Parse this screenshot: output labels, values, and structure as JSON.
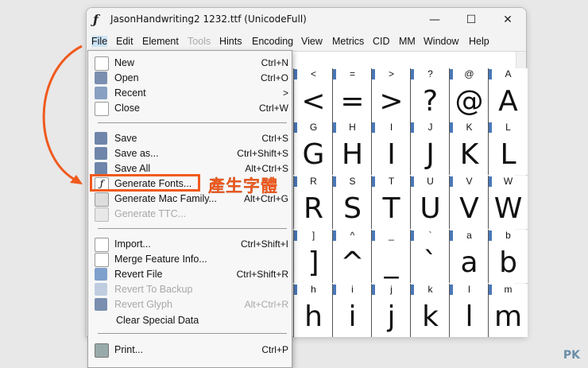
{
  "window": {
    "title": "JasonHandwriting2  1232.ttf (UnicodeFull)",
    "app_icon": "ƒ",
    "minimize_glyph": "—",
    "maximize_glyph": "☐",
    "close_glyph": "✕"
  },
  "menubar": [
    "File",
    "Edit",
    "Element",
    "Tools",
    "Hints",
    "Encoding",
    "View",
    "Metrics",
    "CID",
    "MM",
    "Window",
    "Help"
  ],
  "file_menu": {
    "items": [
      {
        "label": "New",
        "shortcut": "Ctrl+N",
        "icon": "new-file-icon",
        "enabled": true
      },
      {
        "label": "Open",
        "shortcut": "Ctrl+O",
        "icon": "open-icon",
        "enabled": true
      },
      {
        "label": "Recent",
        "shortcut": ">",
        "icon": "recent-icon",
        "enabled": true
      },
      {
        "label": "Close",
        "shortcut": "Ctrl+W",
        "icon": "close-file-icon",
        "enabled": true
      },
      {
        "label": "Save",
        "shortcut": "Ctrl+S",
        "icon": "save-icon",
        "enabled": true
      },
      {
        "label": "Save as...",
        "shortcut": "Ctrl+Shift+S",
        "icon": "save-as-icon",
        "enabled": true
      },
      {
        "label": "Save All",
        "shortcut": "Alt+Ctrl+S",
        "icon": "save-all-icon",
        "enabled": true
      },
      {
        "label": "Generate Fonts...",
        "shortcut": "",
        "icon": "font-icon",
        "enabled": true
      },
      {
        "label": "Generate Mac Family...",
        "shortcut": "Alt+Ctrl+G",
        "icon": "mac-family-icon",
        "enabled": true
      },
      {
        "label": "Generate TTC...",
        "shortcut": "",
        "icon": "ttc-icon",
        "enabled": false
      },
      {
        "label": "Import...",
        "shortcut": "Ctrl+Shift+I",
        "icon": "import-icon",
        "enabled": true
      },
      {
        "label": "Merge Feature Info...",
        "shortcut": "",
        "icon": "merge-icon",
        "enabled": true
      },
      {
        "label": "Revert File",
        "shortcut": "Ctrl+Shift+R",
        "icon": "revert-icon",
        "enabled": true
      },
      {
        "label": "Revert To Backup",
        "shortcut": "",
        "icon": "revert-backup-icon",
        "enabled": false
      },
      {
        "label": "Revert Glyph",
        "shortcut": "Alt+Ctrl+R",
        "icon": "revert-glyph-icon",
        "enabled": false
      },
      {
        "label": "Clear Special Data",
        "shortcut": "",
        "icon": "",
        "enabled": true
      },
      {
        "label": "Print...",
        "shortcut": "Ctrl+P",
        "icon": "print-icon",
        "enabled": true
      }
    ]
  },
  "glyph_grid": {
    "rows": [
      {
        "labels": [
          "<",
          "=",
          ">",
          "?",
          "@",
          "A"
        ],
        "glyphs": [
          "<",
          "=",
          ">",
          "?",
          "@",
          "A"
        ]
      },
      {
        "labels": [
          "G",
          "H",
          "I",
          "J",
          "K",
          "L"
        ],
        "glyphs": [
          "G",
          "H",
          "I",
          "J",
          "K",
          "L"
        ]
      },
      {
        "labels": [
          "R",
          "S",
          "T",
          "U",
          "V",
          "W"
        ],
        "glyphs": [
          "R",
          "S",
          "T",
          "U",
          "V",
          "W"
        ]
      },
      {
        "labels": [
          "]",
          "^",
          "_",
          "`",
          "a",
          "b"
        ],
        "glyphs": [
          "]",
          "^",
          "_",
          "`",
          "a",
          "b"
        ]
      },
      {
        "labels": [
          "h",
          "i",
          "j",
          "k",
          "l",
          "m"
        ],
        "glyphs": [
          "h",
          "i",
          "j",
          "k",
          "l",
          "m"
        ]
      }
    ]
  },
  "annotation": {
    "callout_text": "產生字體",
    "accent_color": "#f05a1e"
  },
  "watermark": "PK"
}
